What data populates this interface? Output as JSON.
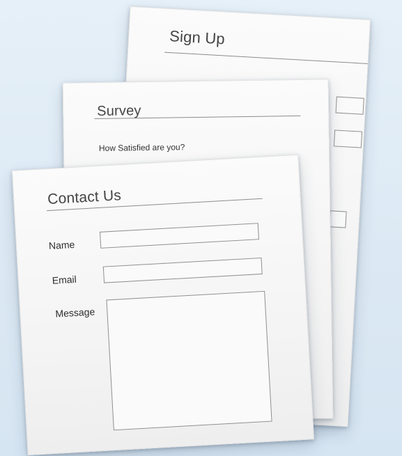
{
  "forms": {
    "signup": {
      "title": "Sign Up"
    },
    "survey": {
      "title": "Survey",
      "question": "How Satisfied are you?"
    },
    "contact": {
      "title": "Contact Us",
      "name_label": "Name",
      "email_label": "Email",
      "message_label": "Message",
      "name_value": "",
      "email_value": "",
      "message_value": ""
    }
  },
  "colors": {
    "background": "#dce9f4",
    "sheet": "#f4f4f4",
    "title_text": "#444444",
    "field_border": "#8f8f8f"
  }
}
